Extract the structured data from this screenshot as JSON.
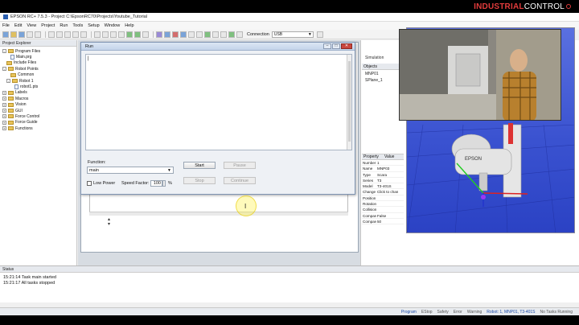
{
  "window": {
    "title": "EPSON RC+ 7.5.3 - Project C:\\EpsonRC70\\Projects\\Youtube_Tutorial"
  },
  "brand": {
    "bold": "INDUSTRIAL",
    "light": "CONTROL"
  },
  "menu": [
    "File",
    "Edit",
    "View",
    "Project",
    "Run",
    "Tools",
    "Setup",
    "Window",
    "Help"
  ],
  "toolbar": {
    "connection_label": "Connection",
    "connection_value": "USB"
  },
  "explorer": {
    "title": "Project Explorer",
    "items": [
      {
        "label": "Program Files",
        "level": 0,
        "type": "folder",
        "exp": "-"
      },
      {
        "label": "Main.prg",
        "level": 2,
        "type": "doc"
      },
      {
        "label": "Include Files",
        "level": 1,
        "type": "folder"
      },
      {
        "label": "Robot Points",
        "level": 0,
        "type": "folder",
        "exp": "-"
      },
      {
        "label": "Common",
        "level": 2,
        "type": "folder"
      },
      {
        "label": "Robot 1",
        "level": 1,
        "type": "folder",
        "exp": "-"
      },
      {
        "label": "robot1.pts",
        "level": 3,
        "type": "doc"
      },
      {
        "label": "Labels",
        "level": 0,
        "type": "folder",
        "exp": "+"
      },
      {
        "label": "Macros",
        "level": 0,
        "type": "folder",
        "exp": "+"
      },
      {
        "label": "Vision",
        "level": 0,
        "type": "folder",
        "exp": "+"
      },
      {
        "label": "GUI",
        "level": 0,
        "type": "folder",
        "exp": "+"
      },
      {
        "label": "Force Control",
        "level": 0,
        "type": "folder",
        "exp": "+"
      },
      {
        "label": "Force Guide",
        "level": 0,
        "type": "folder",
        "exp": "+"
      },
      {
        "label": "Functions",
        "level": 0,
        "type": "folder",
        "exp": "+"
      }
    ]
  },
  "run_dialog": {
    "title": "Run",
    "output_text": "|",
    "function_label": "Function:",
    "function_value": "main",
    "low_power_label": "Low Power",
    "speed_factor_label": "Speed Factor:",
    "speed_factor_value": "100",
    "speed_unit": "%",
    "start_label": "Start",
    "pause_label": "Pause",
    "stop_label": "Stop",
    "continue_label": "Continue"
  },
  "simulator": {
    "tab": "Simulation",
    "objects_header": "Objects",
    "objects": [
      "MNP01",
      "SPlane_1"
    ],
    "prop_headers": [
      "Property",
      "Value"
    ],
    "props": [
      {
        "k": "Number",
        "v": "1"
      },
      {
        "k": "Name",
        "v": "MNP03"
      },
      {
        "k": "Type",
        "v": "Scara"
      },
      {
        "k": "Series",
        "v": "T3"
      },
      {
        "k": "Model",
        "v": "T3-401S"
      },
      {
        "k": "Change R",
        "v": "Click to chan"
      },
      {
        "k": "Position",
        "v": ""
      },
      {
        "k": "Rotation",
        "v": ""
      },
      {
        "k": "Collision",
        "v": ""
      },
      {
        "k": "Compare",
        "v": "False"
      },
      {
        "k": "Compare",
        "v": "50"
      }
    ]
  },
  "status": {
    "title": "Status",
    "lines": [
      "15:21:14 Task main started",
      "15:21:17 All tasks stopped"
    ]
  },
  "statusbar": {
    "items": [
      "Program",
      "EStop",
      "Safety",
      "Error",
      "Warning",
      "Robot: 1, MNP01, T3-401S",
      "No Tasks Running"
    ]
  },
  "colors": {
    "scene_bg": "#3a52d0",
    "accent": "#e23c3c"
  }
}
